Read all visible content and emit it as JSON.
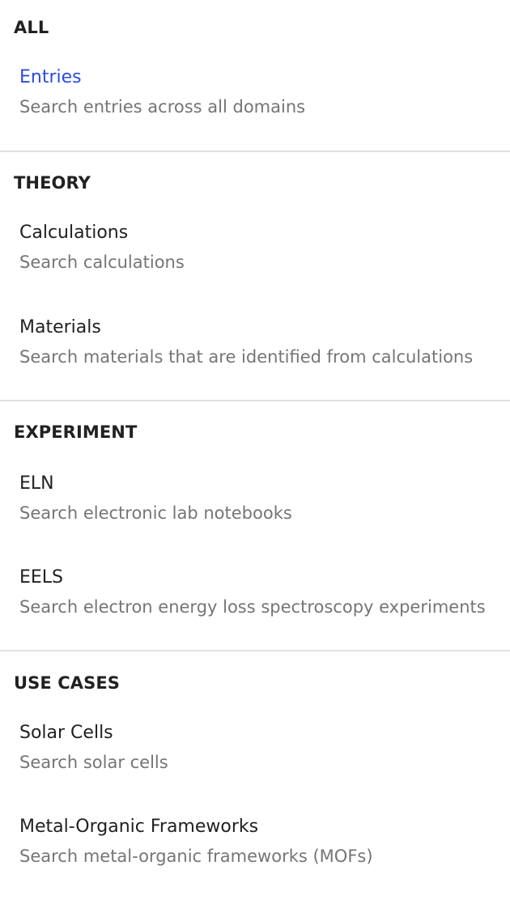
{
  "sections": [
    {
      "title": "ALL",
      "items": [
        {
          "label": "Entries",
          "description": "Search entries across all domains",
          "active": true
        }
      ]
    },
    {
      "title": "THEORY",
      "items": [
        {
          "label": "Calculations",
          "description": "Search calculations"
        },
        {
          "label": "Materials",
          "description": "Search materials that are identified from calculations"
        }
      ]
    },
    {
      "title": "EXPERIMENT",
      "items": [
        {
          "label": "ELN",
          "description": "Search electronic lab notebooks"
        },
        {
          "label": "EELS",
          "description": "Search electron energy loss spectroscopy experiments"
        }
      ]
    },
    {
      "title": "USE CASES",
      "items": [
        {
          "label": "Solar Cells",
          "description": "Search solar cells"
        },
        {
          "label": "Metal-Organic Frameworks",
          "description": "Search metal-organic frameworks (MOFs)"
        }
      ]
    }
  ],
  "colors": {
    "active_link": "#2a4cdf",
    "heading": "#212121",
    "description": "#757575",
    "divider": "#e0e0e0"
  }
}
